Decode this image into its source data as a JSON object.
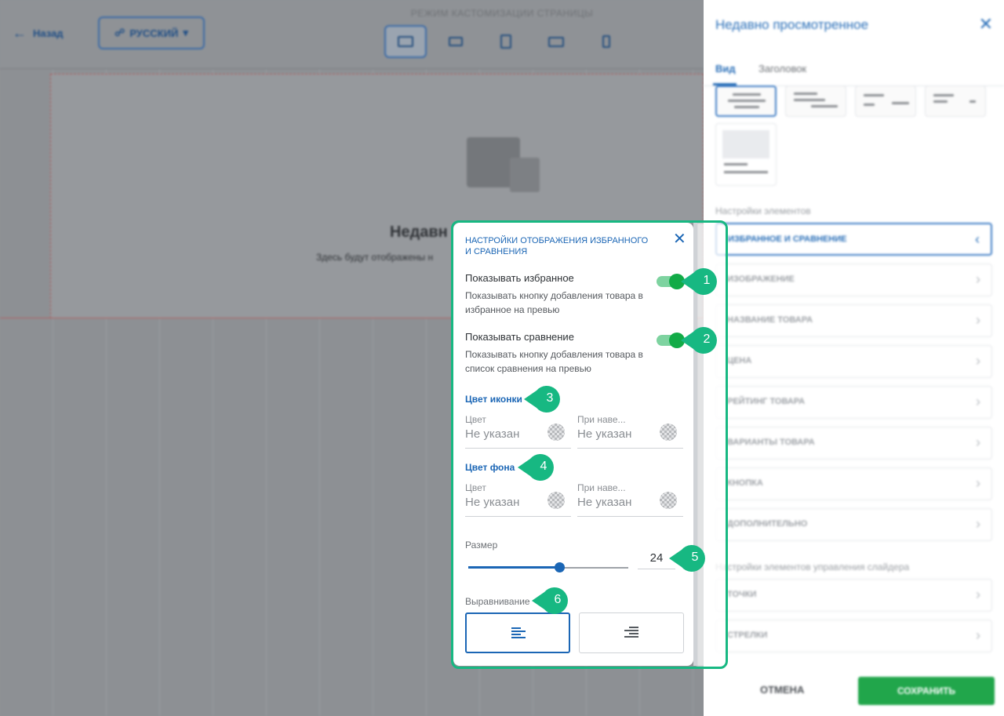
{
  "editor": {
    "back_label": "Назад",
    "language": "РУССКИЙ",
    "mode_title": "РЕЖИМ КАСТОМИЗАЦИИ СТРАНИЦЫ",
    "widget_title": "Недавн",
    "widget_subtitle": "Здесь будут отображены н"
  },
  "sidebar": {
    "title": "Недавно просмотренное",
    "tabs": [
      {
        "label": "Вид"
      },
      {
        "label": "Заголовок"
      }
    ],
    "elements_section": "Настройки элементов",
    "items": [
      {
        "label": "ИЗБРАННОЕ И СРАВНЕНИЕ"
      },
      {
        "label": "ИЗОБРАЖЕНИЕ"
      },
      {
        "label": "НАЗВАНИЕ ТОВАРА"
      },
      {
        "label": "ЦЕНА"
      },
      {
        "label": "РЕЙТИНГ ТОВАРА"
      },
      {
        "label": "ВАРИАНТЫ ТОВАРА"
      },
      {
        "label": "КНОПКА"
      },
      {
        "label": "ДОПОЛНИТЕЛЬНО"
      }
    ],
    "slider_section": "Настройки элементов управления слайдера",
    "slider_items": [
      {
        "label": "ТОЧКИ"
      },
      {
        "label": "СТРЕЛКИ"
      }
    ],
    "cancel_label": "ОТМЕНА",
    "save_label": "СОХРАНИТЬ"
  },
  "panel": {
    "title": "НАСТРОЙКИ ОТОБРАЖЕНИЯ ИЗБРАННОГО И СРАВНЕНИЯ",
    "show_favorites": {
      "title": "Показывать избранное",
      "description": "Показывать кнопку добавления товара в избранное на превью",
      "enabled": true
    },
    "show_compare": {
      "title": "Показывать сравнение",
      "description": "Показывать кнопку добавления товара в список сравнения на превью",
      "enabled": true
    },
    "icon_color": {
      "label": "Цвет иконки",
      "color": {
        "label": "Цвет",
        "value": "Не указан"
      },
      "hover": {
        "label": "При наве...",
        "value": "Не указан"
      }
    },
    "bg_color": {
      "label": "Цвет фона",
      "color": {
        "label": "Цвет",
        "value": "Не указан"
      },
      "hover": {
        "label": "При наве...",
        "value": "Не указан"
      }
    },
    "size": {
      "label": "Размер",
      "value": "24",
      "slider_fraction": 0.57
    },
    "alignment": {
      "label": "Выравнивание",
      "selected": "left"
    }
  },
  "callouts": [
    "1",
    "2",
    "3",
    "4",
    "5",
    "6"
  ],
  "colors": {
    "accent": "#1b66b5",
    "highlight": "#17b882",
    "toggle_on": "#12ab47",
    "save_button": "#21a64b"
  }
}
